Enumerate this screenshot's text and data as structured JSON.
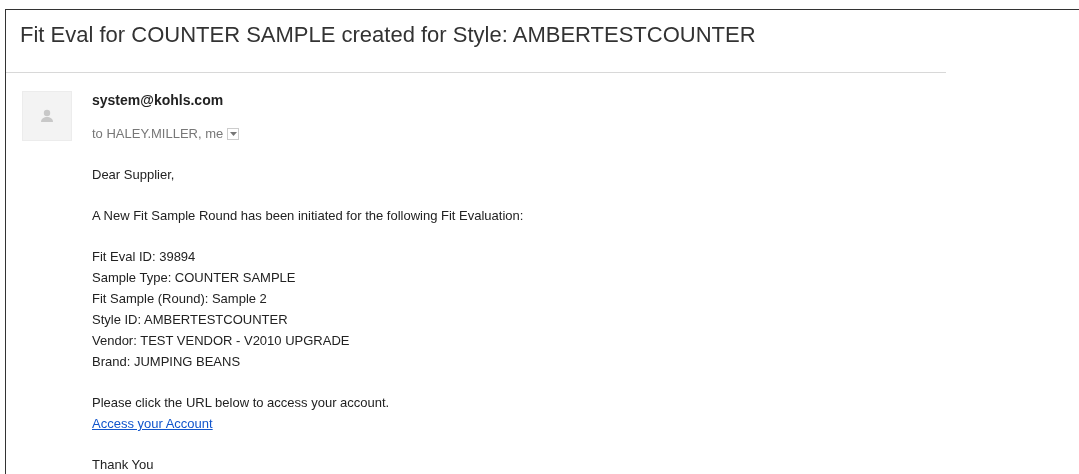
{
  "subject": "Fit Eval for COUNTER SAMPLE created for Style: AMBERTESTCOUNTER",
  "sender": "system@kohls.com",
  "recipients": "to HALEY.MILLER, me",
  "greeting": "Dear Supplier,",
  "intro": "A New Fit Sample Round has been initiated for the following Fit Evaluation:",
  "details": [
    "Fit Eval ID: 39894",
    "Sample Type: COUNTER SAMPLE",
    "Fit Sample (Round): Sample 2",
    "Style ID: AMBERTESTCOUNTER",
    "Vendor: TEST VENDOR - V2010 UPGRADE",
    "Brand: JUMPING BEANS"
  ],
  "instruction": "Please click the URL below to access your account.",
  "link": "Access your Account",
  "closing": "Thank You"
}
